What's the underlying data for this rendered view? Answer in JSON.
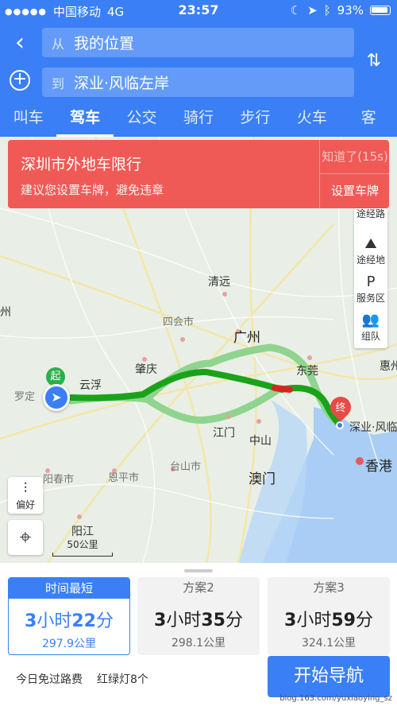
{
  "status_bar": {
    "carrier": "中国移动",
    "network": "4G",
    "time": "23:57",
    "battery": "93%"
  },
  "search": {
    "from_prefix": "从",
    "from_value": "我的位置",
    "to_prefix": "到",
    "to_value": "深业·风临左岸"
  },
  "tabs": [
    {
      "label": "叫车"
    },
    {
      "label": "驾车"
    },
    {
      "label": "公交"
    },
    {
      "label": "骑行"
    },
    {
      "label": "步行"
    },
    {
      "label": "火车"
    },
    {
      "label": "客"
    }
  ],
  "alert": {
    "title": "深圳市外地车限行",
    "subtitle": "建议您设置车牌，避免违章",
    "dismiss": "知道了(15s)",
    "action": "设置车牌"
  },
  "side_panel": {
    "waypoint_route": "途经路",
    "waypoint_place": "途经地",
    "service": "服务区",
    "team": "组队"
  },
  "map": {
    "start_marker": "起",
    "end_marker": "终",
    "labels": {
      "qingyuan": "清远",
      "sihui": "四会市",
      "guangzhou": "广州",
      "zhaoqing": "肇庆",
      "yunfu": "云浮",
      "dongguan": "东莞",
      "huizhou": "惠州",
      "luoding": "罗定",
      "jiangmen": "江门",
      "zhongshan": "中山",
      "taishan": "台山市",
      "aomen": "澳门",
      "yangchun": "阳春市",
      "enping": "恩平市",
      "yangjiang": "阳江",
      "shenye": "深业·风临",
      "hongkong": "香港",
      "edge_zhou": "州"
    },
    "prefer": "偏好",
    "scale": "50公里"
  },
  "plans": [
    {
      "header": "时间最短",
      "hours": "3",
      "h_unit": "小时",
      "minutes": "22",
      "m_unit": "分",
      "distance": "297.9公里"
    },
    {
      "header": "方案2",
      "hours": "3",
      "h_unit": "小时",
      "minutes": "35",
      "m_unit": "分",
      "distance": "298.1公里"
    },
    {
      "header": "方案3",
      "hours": "3",
      "h_unit": "小时",
      "minutes": "59",
      "m_unit": "分",
      "distance": "324.1公里"
    }
  ],
  "bottom_info": {
    "toll": "今日免过路费",
    "lights": "红绿灯8个"
  },
  "start_nav": "开始导航",
  "watermark": "blog.163.com/yuxiaoying_sz",
  "colors": {
    "accent": "#3a7ff6",
    "alert": "#f05a56",
    "route": "#1aa31a",
    "alt_route": "#8fd48f"
  }
}
